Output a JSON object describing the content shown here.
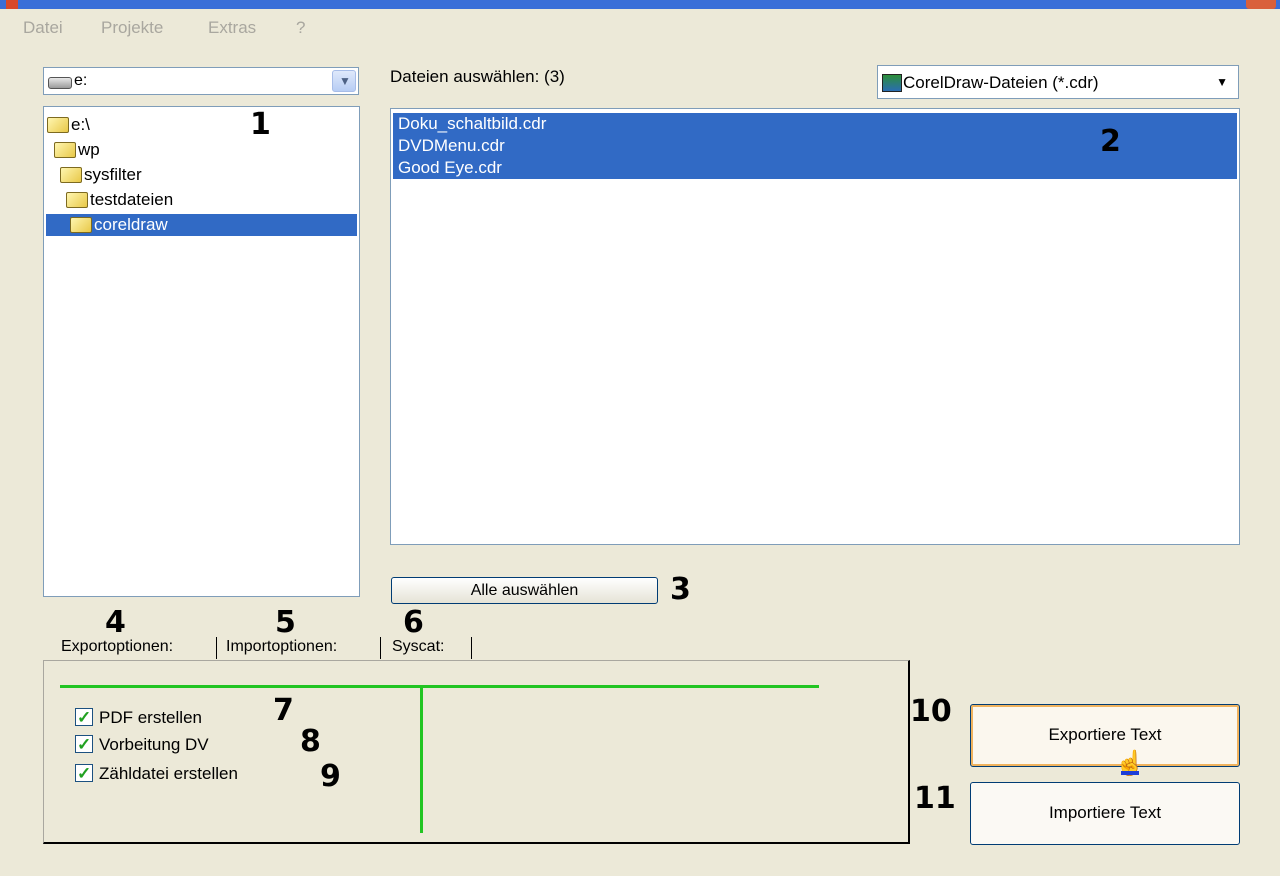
{
  "menu": [
    "Datei",
    "Projekte",
    "Extras",
    "?"
  ],
  "drive": {
    "label": "e:",
    "icon": "drive-icon"
  },
  "folders": [
    "e:\\",
    "wp",
    "sysfilter",
    "testdateien",
    "coreldraw"
  ],
  "files_label": "Dateien auswählen: (3)",
  "filter": "CorelDraw-Dateien (*.cdr)",
  "files": [
    "Doku_schaltbild.cdr",
    "DVDMenu.cdr",
    "Good Eye.cdr"
  ],
  "select_all": "Alle auswählen",
  "tabs": [
    "Exportoptionen:",
    "Importoptionen:",
    "Syscat:"
  ],
  "options": [
    {
      "label": "PDF erstellen",
      "checked": true
    },
    {
      "label": "Vorbeitung DV",
      "checked": true
    },
    {
      "label": "Zähldatei erstellen",
      "checked": true
    }
  ],
  "buttons": {
    "export": "Exportiere Text",
    "import": "Importiere Text"
  },
  "callouts": [
    "1",
    "2",
    "3",
    "4",
    "5",
    "6",
    "7",
    "8",
    "9",
    "10",
    "11"
  ],
  "colors": {
    "selection": "#316ac5",
    "accent_line": "#22c522",
    "background": "#ece9d8"
  }
}
